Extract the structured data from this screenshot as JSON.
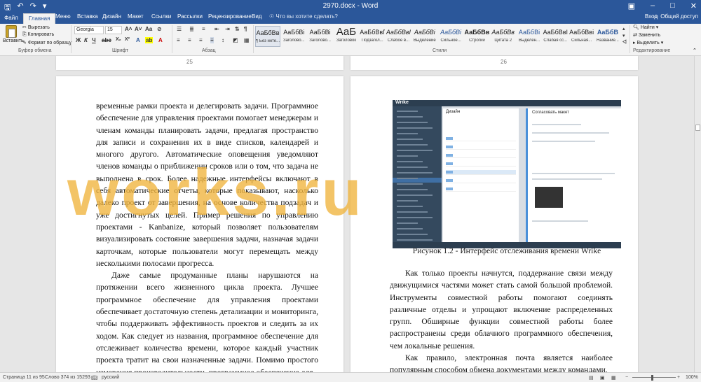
{
  "titlebar": {
    "doc_title": "2970.docx - Word",
    "save_icon": "save-icon",
    "undo_icon": "undo-icon",
    "redo_icon": "redo-icon"
  },
  "tabs": [
    "Файл",
    "Главная",
    "Меню",
    "Вставка",
    "Дизайн",
    "Макет",
    "Ссылки",
    "Рассылки",
    "Рецензирование",
    "Вид"
  ],
  "tell_me": "Что вы хотите сделать?",
  "sign_in": "Вход",
  "share": "Общий доступ",
  "clipboard": {
    "paste": "Вставить",
    "cut": "Вырезать",
    "copy": "Копировать",
    "format_painter": "Формат по образцу",
    "group_label": "Буфер обмена"
  },
  "font": {
    "family": "Georgia",
    "size": "15",
    "bold": "Ж",
    "italic": "К",
    "underline": "Ч",
    "group_label": "Шрифт"
  },
  "paragraph": {
    "group_label": "Абзац"
  },
  "styles": {
    "group_label": "Стили",
    "items": [
      {
        "preview": "АаБбВв",
        "name": "¶ Без инте..."
      },
      {
        "preview": "АаБбВі",
        "name": "Заголово..."
      },
      {
        "preview": "АаБбВі",
        "name": "Заголово..."
      },
      {
        "preview": "АаБ",
        "name": "Заголовок"
      },
      {
        "preview": "АаБбВвГ",
        "name": "Подзагол..."
      },
      {
        "preview": "АаБбВвІ",
        "name": "Слабое в..."
      },
      {
        "preview": "АаБбВі",
        "name": "Выделение"
      },
      {
        "preview": "АаБбВі",
        "name": "Сильное..."
      },
      {
        "preview": "АаБбВв",
        "name": "Строгий"
      },
      {
        "preview": "АаБбВв",
        "name": "Цитата 2"
      },
      {
        "preview": "АаБбВі",
        "name": "Выделен..."
      },
      {
        "preview": "АаБбВвІ",
        "name": "Слабая сс..."
      },
      {
        "preview": "АаБбВві",
        "name": "Сильная..."
      },
      {
        "preview": "АаБбВ",
        "name": "Название..."
      }
    ]
  },
  "editing": {
    "find": "Найти",
    "replace": "Заменить",
    "select": "Выделить",
    "group_label": "Редактирование"
  },
  "page_numbers": {
    "left": "25",
    "right": "26"
  },
  "left_page_text": [
    "временные рамки проекта и делегировать задачи. Программное обеспечение для управления проектами помогает менеджерам и членам команды планировать задачи, предлагая пространство для записи и сохранения их в виде списков, календарей и многого другого. Автоматические оповещения уведомляют членов команды о приближении сроков или о том, что задача не выполнена в срок. Более надежные интерфейсы включают в себя автоматические отчеты, которые показывают, насколько далеко проект от завершения, на основе количества подзадач и уже достигнутых целей. Пример решения по управлению проектами - Kanbanize, который позволяет пользователям визуализировать состояние завершения задачи, назначая задачи карточкам, которые пользователи могут перемещать между несколькими полосами прогресса.",
    "Даже самые продуманные планы нарушаются на протяжении всего жизненного цикла проекта. Лучшее программное обеспечение для управления проектами обеспечивает достаточную степень детализации и мониторинга, чтобы поддерживать эффективность проектов и следить за их ходом. Как следует из названия, программное обеспечение для отслеживает количества времени, которое каждый участник проекта тратит на свои назначенные задачи. Помимо простого измерения производительности, программное обеспечение для"
  ],
  "figure": {
    "caption": "Рисунок 1.2 - Интерфейс отслеживания времени Wrike",
    "app_logo": "Wrike",
    "list_title": "Дизайн",
    "detail_title": "Согласовать макет"
  },
  "right_page_text": [
    "Как только проекты начнутся, поддержание связи между движущимися частями может стать самой большой проблемой. Инструменты совместной работы помогают соединять различные отделы и упрощают включение распределенных групп. Обширные функции совместной работы более распространены среди облачного программного обеспечения, чем локальные решения.",
    "Как правило, электронная почта является наиболее популярным способом обмена документами между командами,"
  ],
  "watermark": "works.ru",
  "status": {
    "page": "Страница 11 из 95",
    "words": "Слово 374 из 15293",
    "lang": "русский",
    "zoom": "100%"
  },
  "colors": {
    "accent": "#2b579a",
    "watermark": "#f0b43c"
  }
}
